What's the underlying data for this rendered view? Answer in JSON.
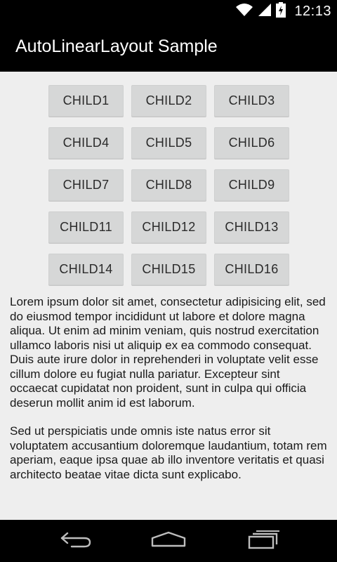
{
  "status_bar": {
    "time": "12:13",
    "icons": [
      "wifi-icon",
      "signal-icon",
      "battery-icon"
    ]
  },
  "action_bar": {
    "title": "AutoLinearLayout Sample"
  },
  "buttons": [
    "CHILD1",
    "CHILD2",
    "CHILD3",
    "CHILD4",
    "CHILD5",
    "CHILD6",
    "CHILD7",
    "CHILD8",
    "CHILD9",
    "CHILD11",
    "CHILD12",
    "CHILD13",
    "CHILD14",
    "CHILD15",
    "CHILD16"
  ],
  "text": {
    "paragraph1": "Lorem ipsum dolor sit amet, consectetur adipisicing elit, sed do eiusmod tempor incididunt ut labore et dolore magna aliqua. Ut enim ad minim veniam, quis nostrud exercitation ullamco laboris nisi ut aliquip ex ea commodo consequat. Duis aute irure dolor in reprehenderi in voluptate velit esse cillum dolore eu fugiat nulla pariatur. Excepteur sint occaecat cupidatat non proident, sunt in culpa qui officia deserun mollit anim id est laborum.",
    "paragraph2": "Sed ut perspiciatis unde omnis iste natus error sit voluptatem accusantium doloremque laudantium, totam rem aperiam, eaque ipsa quae ab illo inventore veritatis et quasi architecto beatae vitae dicta sunt explicabo."
  },
  "nav_bar": {
    "icons": [
      "back-icon",
      "home-icon",
      "recent-apps-icon"
    ]
  },
  "colors": {
    "background": "#eeeeee",
    "bars": "#000000",
    "button": "#d6d7d7",
    "text": "#1a1a1a"
  }
}
